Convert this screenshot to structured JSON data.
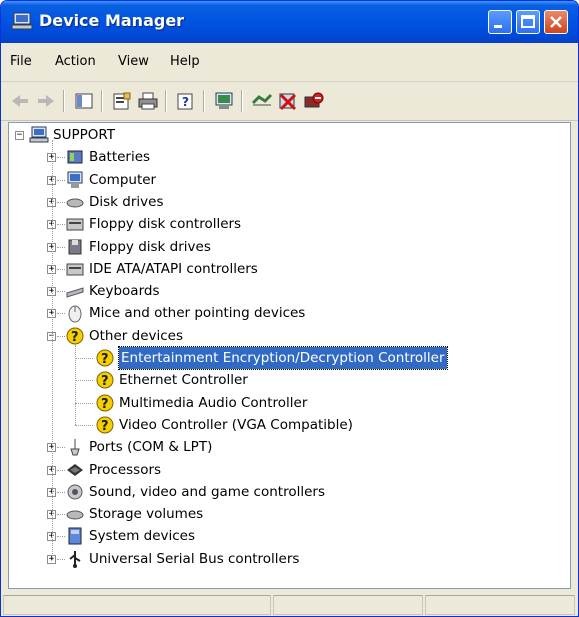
{
  "window": {
    "title": "Device Manager"
  },
  "menu": [
    "File",
    "Action",
    "View",
    "Help"
  ],
  "toolbar": {
    "icons": [
      "back-arrow-icon",
      "forward-arrow-icon",
      "show-hide-console-tree-icon",
      "properties-icon",
      "print-icon",
      "help-icon",
      "scan-hardware-icon",
      "update-driver-icon",
      "uninstall-icon",
      "disable-icon"
    ]
  },
  "tree": {
    "root": "SUPPORT",
    "items": [
      {
        "label": "Batteries"
      },
      {
        "label": "Computer"
      },
      {
        "label": "Disk drives"
      },
      {
        "label": "Floppy disk controllers"
      },
      {
        "label": "Floppy disk drives"
      },
      {
        "label": "IDE ATA/ATAPI controllers"
      },
      {
        "label": "Keyboards"
      },
      {
        "label": "Mice and other pointing devices"
      },
      {
        "label": "Other devices",
        "children": [
          "Entertainment Encryption/Decryption Controller",
          "Ethernet Controller",
          "Multimedia Audio Controller",
          "Video Controller (VGA Compatible)"
        ]
      },
      {
        "label": "Ports (COM & LPT)"
      },
      {
        "label": "Processors"
      },
      {
        "label": "Sound, video and game controllers"
      },
      {
        "label": "Storage volumes"
      },
      {
        "label": "System devices"
      },
      {
        "label": "Universal Serial Bus controllers"
      }
    ],
    "selected": "Entertainment Encryption/Decryption Controller"
  },
  "colors": {
    "titlebar": "#0054e3",
    "selection": "#316ac5",
    "warning": "#f5d000"
  }
}
